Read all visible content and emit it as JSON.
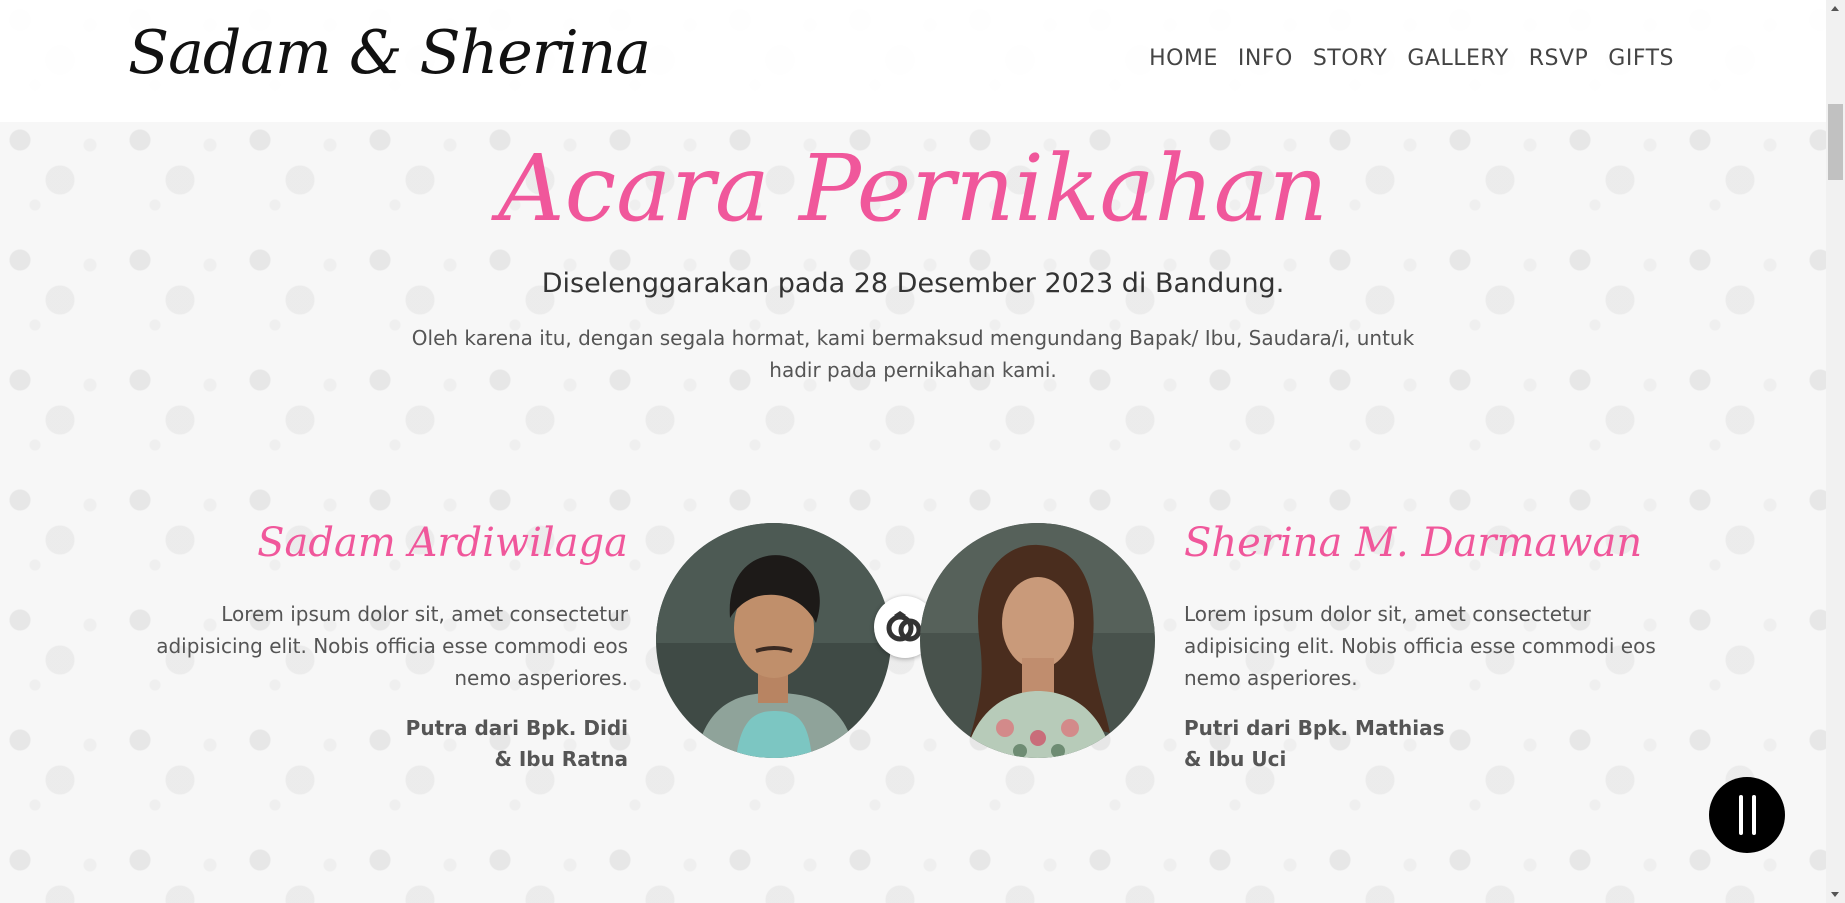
{
  "navbar": {
    "brand": "Sadam & Sherina",
    "links": [
      "HOME",
      "INFO",
      "STORY",
      "GALLERY",
      "RSVP",
      "GIFTS"
    ]
  },
  "event": {
    "title": "Acara Pernikahan",
    "date_line": "Diselenggarakan pada 28 Desember 2023 di Bandung.",
    "description": "Oleh karena itu, dengan segala hormat, kami bermaksud mengundang Bapak/ Ibu, Saudara/i, untuk hadir pada pernikahan kami."
  },
  "groom": {
    "name": "Sadam Ardiwilaga",
    "bio": "Lorem ipsum dolor sit, amet consectetur adipisicing elit. Nobis officia esse commodi eos nemo asperiores.",
    "parents_line1": "Putra dari Bpk. Didi",
    "parents_line2": "& Ibu Ratna"
  },
  "bride": {
    "name": "Sherina M. Darmawan",
    "bio": "Lorem ipsum dolor sit, amet consectetur adipisicing elit. Nobis officia esse commodi eos nemo asperiores.",
    "parents_line1": "Putri dari Bpk. Mathias",
    "parents_line2": "& Ibu Uci"
  },
  "icons": {
    "rings": "rings-icon",
    "music": "pause-icon"
  },
  "colors": {
    "accent": "#f0579b",
    "music_button": "#000000"
  }
}
